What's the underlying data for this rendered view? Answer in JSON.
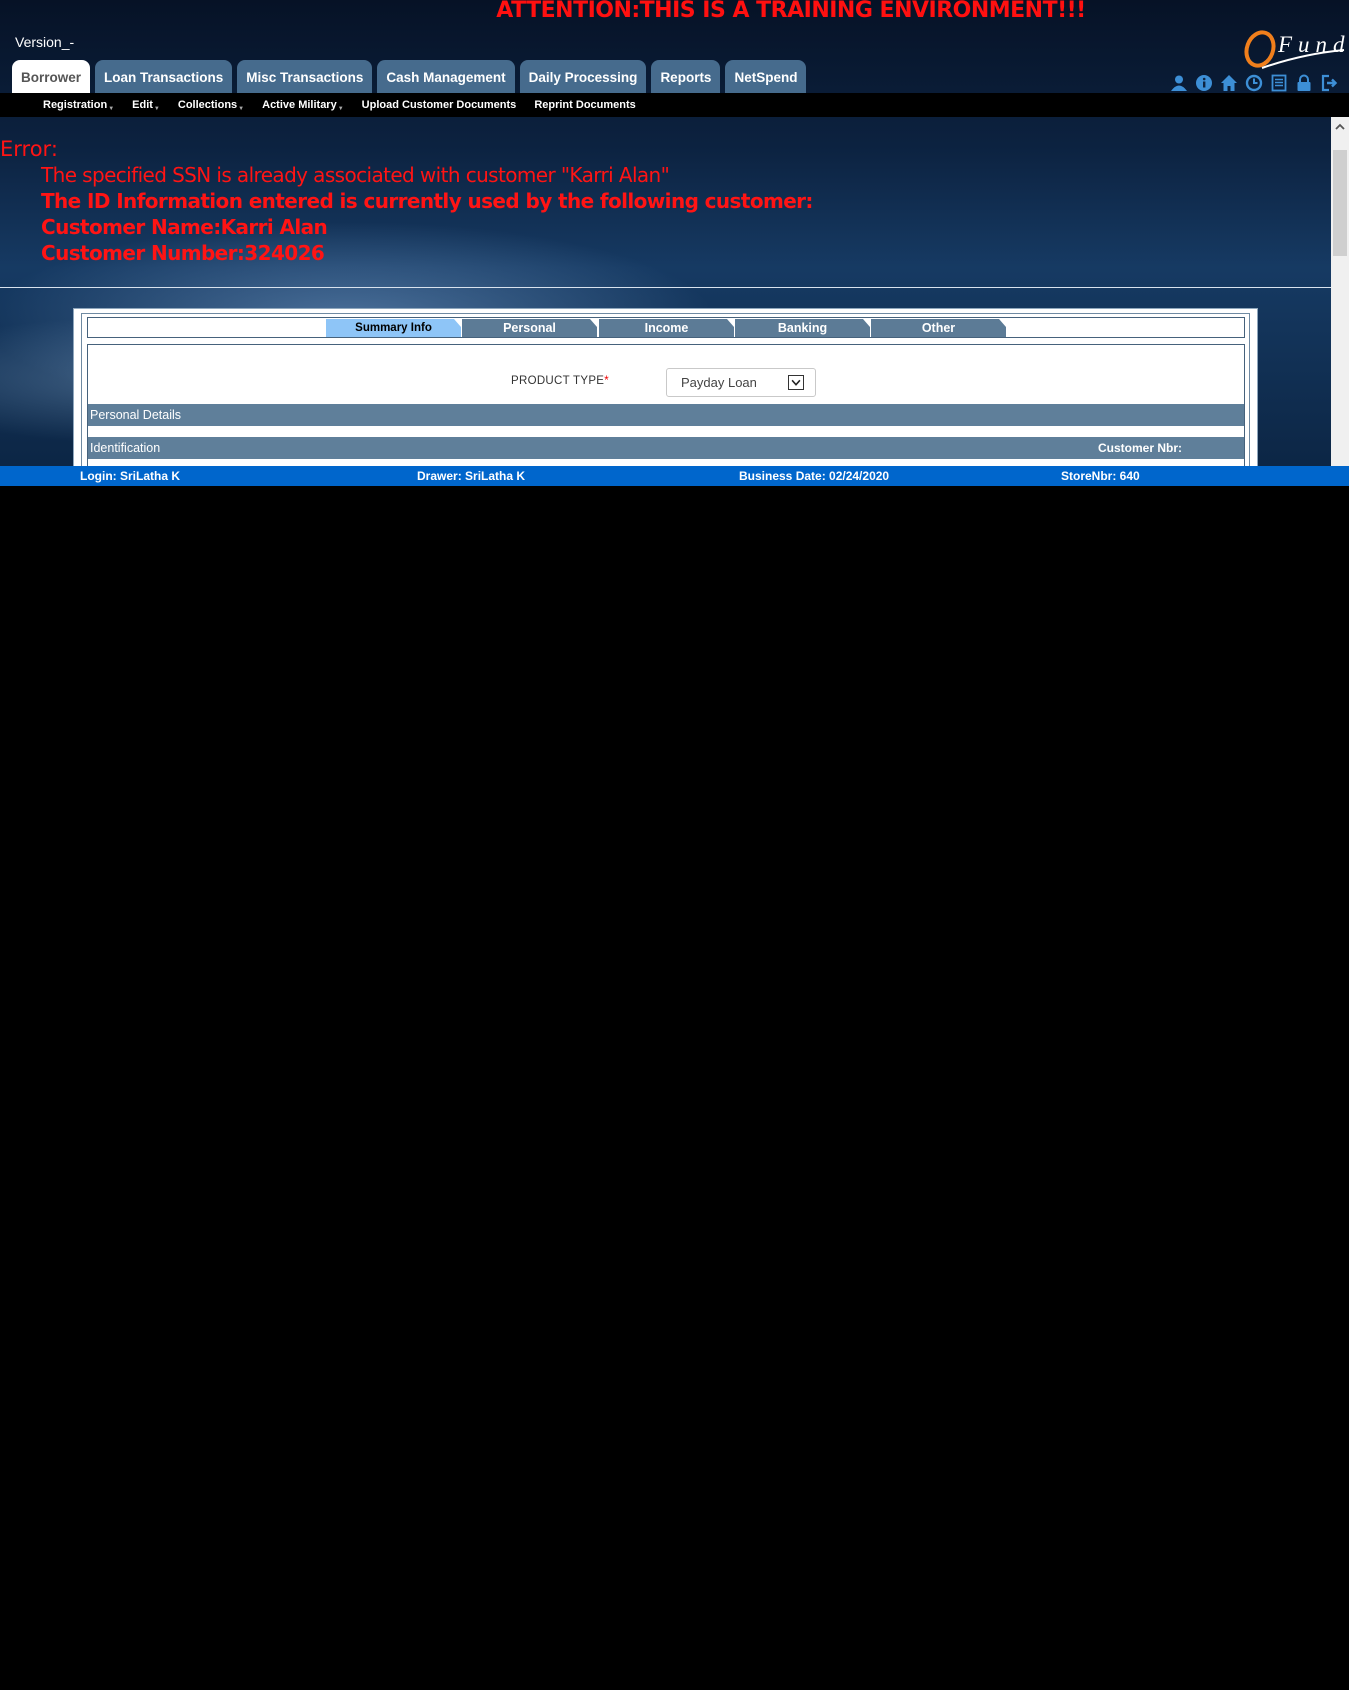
{
  "banner": "ATTENTION:THIS IS A TRAINING ENVIRONMENT!!!",
  "version": "Version_-",
  "logo": {
    "name": "qfund-logo",
    "text": "Fund",
    "colors": {
      "ring": "#f07f1c",
      "text": "#ffffff"
    }
  },
  "main_tabs": [
    {
      "label": "Borrower",
      "active": true
    },
    {
      "label": "Loan Transactions",
      "active": false
    },
    {
      "label": "Misc Transactions",
      "active": false
    },
    {
      "label": "Cash Management",
      "active": false
    },
    {
      "label": "Daily Processing",
      "active": false
    },
    {
      "label": "Reports",
      "active": false
    },
    {
      "label": "NetSpend",
      "active": false
    }
  ],
  "top_icons": [
    "user-icon",
    "info-icon",
    "home-icon",
    "clock-icon",
    "document-icon",
    "lock-icon",
    "logout-icon"
  ],
  "sub_nav": [
    {
      "label": "Registration",
      "has_menu": true
    },
    {
      "label": "Edit",
      "has_menu": true
    },
    {
      "label": "Collections",
      "has_menu": true
    },
    {
      "label": "Active Military",
      "has_menu": true
    },
    {
      "label": "Upload Customer Documents",
      "has_menu": false
    },
    {
      "label": "Reprint Documents",
      "has_menu": false
    }
  ],
  "error": {
    "title": "Error:",
    "lines": [
      "The specified SSN is already associated with customer \"Karri Alan\"",
      "The ID Information entered is currently used by the following customer:",
      "Customer Name:Karri Alan",
      "Customer Number:324026"
    ]
  },
  "form_steps": [
    {
      "label": "Summary Info",
      "active": true
    },
    {
      "label": "Personal",
      "active": false
    },
    {
      "label": "Income",
      "active": false
    },
    {
      "label": "Banking",
      "active": false
    },
    {
      "label": "Other",
      "active": false
    }
  ],
  "product_type": {
    "label": "PRODUCT TYPE",
    "required_mark": "*",
    "value": "Payday Loan"
  },
  "sections": {
    "personal_details": "Personal Details",
    "identification": "Identification",
    "customer_nbr_label": "Customer Nbr:"
  },
  "status_bar": {
    "login": "Login:  SriLatha K",
    "drawer": "Drawer:  SriLatha K",
    "business_date": "Business Date: 02/24/2020",
    "store": "StoreNbr: 640"
  },
  "colors": {
    "error_text": "#ff1414",
    "status_bar": "#0066cc",
    "tab_bg": "#466b8d",
    "step_active": "#8ec5f7"
  }
}
